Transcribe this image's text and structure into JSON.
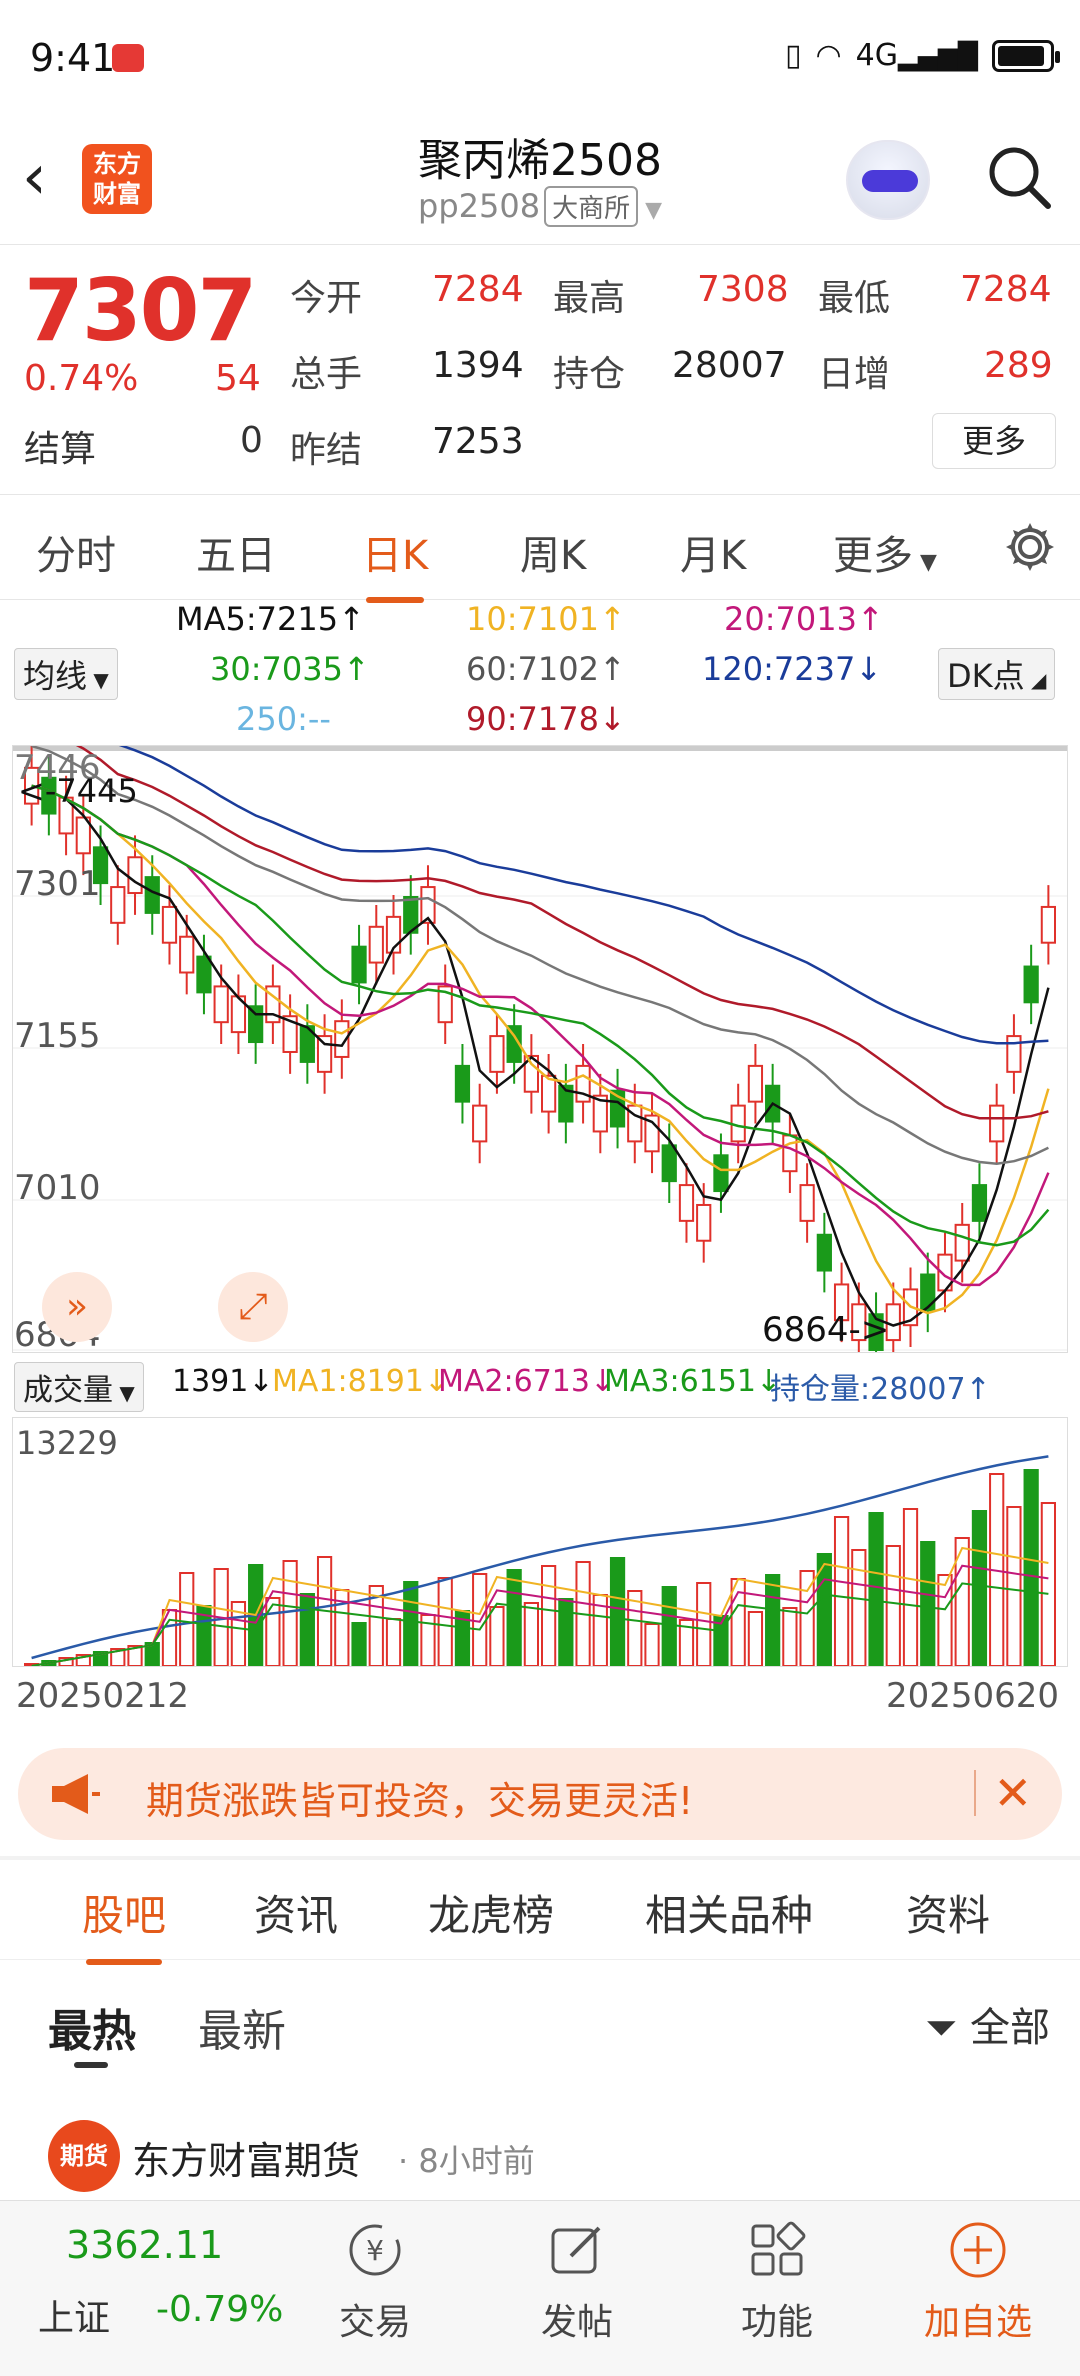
{
  "status": {
    "time": "9:41",
    "net": "4G"
  },
  "header": {
    "title": "聚丙烯2508",
    "code": "pp2508",
    "exchange": "大商所",
    "logo_line1": "东方",
    "logo_line2": "财富"
  },
  "quote": {
    "price": "7307",
    "pct": "0.74%",
    "change": "54",
    "settle_label": "结算",
    "settle_value": "0",
    "open_label": "今开",
    "open": "7284",
    "high_label": "最高",
    "high": "7308",
    "low_label": "最低",
    "low": "7284",
    "volume_label": "总手",
    "volume": "1394",
    "oi_label": "持仓",
    "oi": "28007",
    "daily_inc_label": "日增",
    "daily_inc": "289",
    "prev_settle_label": "昨结",
    "prev_settle": "7253",
    "more": "更多"
  },
  "tabs": [
    "分时",
    "五日",
    "日K",
    "周K",
    "月K",
    "更多"
  ],
  "ma": {
    "selector": "均线",
    "dk": "DK点",
    "ma5": "MA5:7215↑",
    "ma10": "10:7101↑",
    "ma20": "20:7013↑",
    "ma30": "30:7035↑",
    "ma60": "60:7102↑",
    "ma120": "120:7237↓",
    "ma250": "250:--",
    "ma90": "90:7178↓"
  },
  "colors": {
    "up": "#e0312b",
    "down": "#1a9a1a",
    "accent": "#e35b1a",
    "ma5": "#111111",
    "ma10": "#f0b323",
    "ma20": "#c2187a",
    "ma30": "#1a9a1a",
    "ma60": "#777777",
    "ma120": "#1a3c9a",
    "ma90": "#b01a2a"
  },
  "chart": {
    "y_labels": [
      "7446",
      "7301",
      "7155",
      "7010",
      "6864"
    ],
    "hi_label": "<-7445",
    "lo_label": "6864->",
    "start_date": "20250212",
    "end_date": "20250620"
  },
  "volume": {
    "selector": "成交量",
    "current": "1391↓",
    "ma1": "MA1:8191↓",
    "ma2": "MA2:6713↓",
    "ma3": "MA3:6151↓",
    "oi": "持仓量:28007↑",
    "max_label": "13229"
  },
  "banner": {
    "text": "期货涨跌皆可投资，交易更灵活!"
  },
  "tabs2": [
    "股吧",
    "资讯",
    "龙虎榜",
    "相关品种",
    "资料"
  ],
  "feed": {
    "hot": "最热",
    "new": "最新",
    "filter": "全部"
  },
  "post": {
    "avatar_text": "期货",
    "name": "东方财富期货",
    "time": "· 8小时前"
  },
  "bottom": {
    "index_value": "3362.11",
    "index_name": "上证",
    "index_pct": "-0.79%",
    "nav": [
      "交易",
      "发帖",
      "功能",
      "加自选"
    ]
  }
}
